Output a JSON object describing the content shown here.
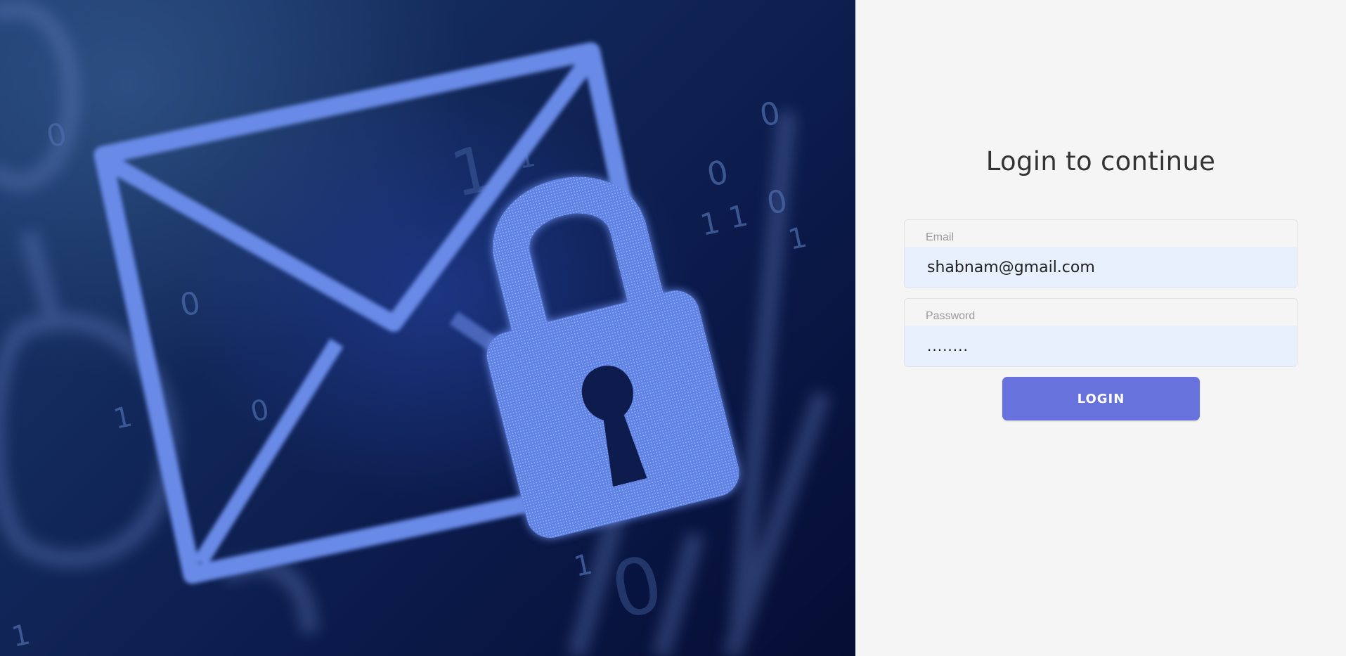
{
  "hero": {
    "image": "email-envelope-with-padlock-on-binary-background",
    "icons": [
      "envelope-icon",
      "padlock-icon"
    ]
  },
  "login": {
    "title": "Login to continue",
    "email": {
      "label": "Email",
      "value": "shabnam@gmail.com"
    },
    "password": {
      "label": "Password",
      "value": "........"
    },
    "button_label": "LOGIN"
  },
  "colors": {
    "panel_background": "#f5f5f5",
    "input_background": "#e8effd",
    "button": "#6772dd",
    "title_text": "#333333",
    "hero_dark": "#050d33",
    "hero_glow": "#6f8fe8"
  }
}
